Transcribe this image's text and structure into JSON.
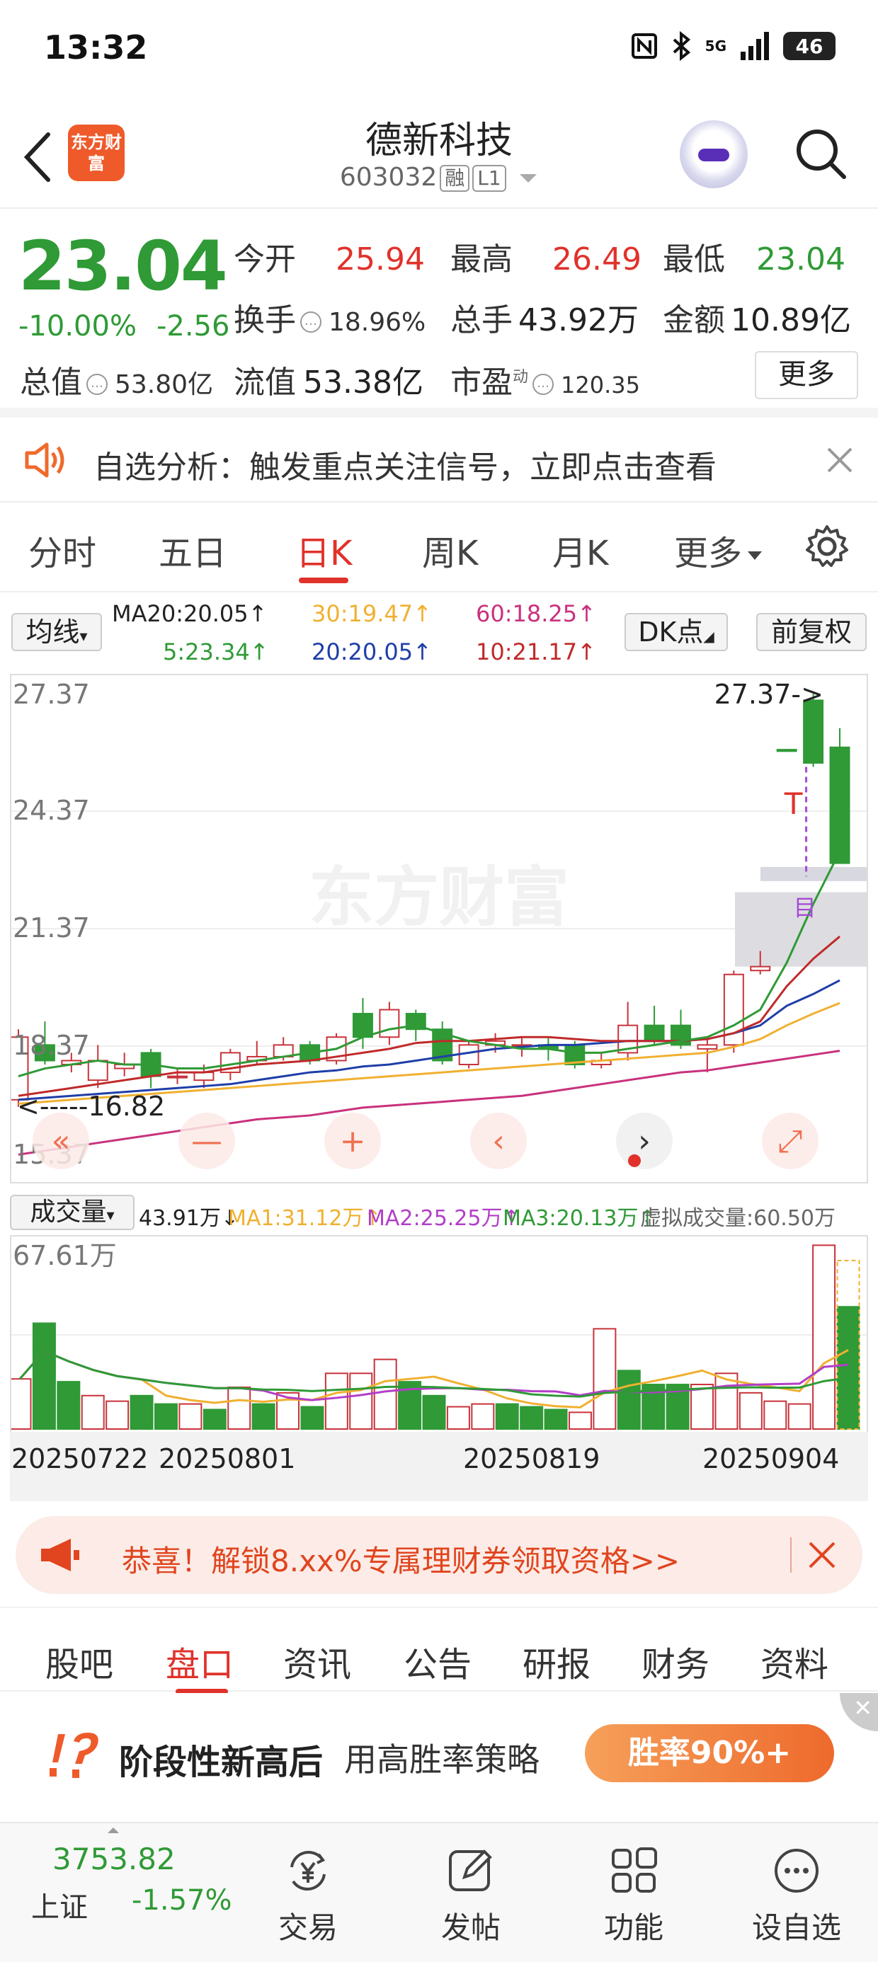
{
  "status_bar": {
    "time": "13:32",
    "network": "5G",
    "battery": "46"
  },
  "header": {
    "logo_text": "东方财富",
    "stock_name": "德新科技",
    "stock_code": "603032",
    "tag_margin": "融",
    "tag_level": "L1"
  },
  "quote": {
    "price": "23.04",
    "change_pct": "-10.00%",
    "change_abs": "-2.56",
    "open_label": "今开",
    "open": "25.94",
    "high_label": "最高",
    "high": "26.49",
    "low_label": "最低",
    "low": "23.04",
    "turnover_label": "换手",
    "turnover": "18.96%",
    "volume_label": "总手",
    "volume": "43.92万",
    "amount_label": "金额",
    "amount": "10.89亿",
    "mktcap_label": "总值",
    "mktcap": "53.80亿",
    "float_label": "流值",
    "float_cap": "53.38亿",
    "pe_label": "市盈",
    "pe_sup": "动",
    "pe": "120.35",
    "more_label": "更多"
  },
  "notice": {
    "text": "自选分析：触发重点关注信号，立即点击查看"
  },
  "ktabs": [
    "分时",
    "五日",
    "日K",
    "周K",
    "月K",
    "更多"
  ],
  "ma": {
    "select_label": "均线",
    "ma20_top": "MA20:20.05↑",
    "ma30": "30:19.47↑",
    "ma60": "60:18.25↑",
    "ma5": "5:23.34↑",
    "ma20": "20:20.05↑",
    "ma10": "10:21.17↑",
    "dk_label": "DK点",
    "adjust_label": "前复权"
  },
  "kchart": {
    "watermark": "东方财富",
    "y_labels": [
      "27.37",
      "24.37",
      "21.37",
      "18.37",
      "15.37"
    ],
    "max_marker": "27.37->",
    "min_marker": "<-----16.82",
    "mark_t": "T",
    "mark_b": "目"
  },
  "volume": {
    "select_label": "成交量",
    "current": "43.91万↓",
    "ma1": "MA1:31.12万↑",
    "ma2": "MA2:25.25万↑",
    "ma3": "MA3:20.13万↑",
    "virtual": "虚拟成交量:60.50万",
    "y_max": "67.61万"
  },
  "dates": [
    "20250722",
    "20250801",
    "20250819",
    "20250904"
  ],
  "promo": {
    "text": "恭喜！解锁8.xx%专属理财券领取资格>>"
  },
  "subtabs": [
    "股吧",
    "盘口",
    "资讯",
    "公告",
    "研报",
    "财务",
    "资料"
  ],
  "ad": {
    "title1": "阶段性新高后",
    "title2": "用高胜率策略",
    "button": "胜率90%+"
  },
  "bottom": {
    "index_value": "3753.82",
    "index_name": "上证",
    "index_change": "-1.57%",
    "nav": [
      "交易",
      "发帖",
      "功能",
      "设自选"
    ]
  },
  "chart_data": {
    "type": "candlestick",
    "title": "",
    "y_range": [
      15.37,
      27.37
    ],
    "candles": [
      {
        "o": 17.0,
        "c": 18.6,
        "h": 18.8,
        "l": 16.82
      },
      {
        "o": 18.4,
        "c": 18.0,
        "h": 19.0,
        "l": 17.9
      },
      {
        "o": 17.9,
        "c": 18.0,
        "h": 18.2,
        "l": 17.7
      },
      {
        "o": 17.5,
        "c": 18.0,
        "h": 18.4,
        "l": 17.3
      },
      {
        "o": 17.8,
        "c": 17.9,
        "h": 18.2,
        "l": 17.6
      },
      {
        "o": 18.2,
        "c": 17.6,
        "h": 18.3,
        "l": 17.3
      },
      {
        "o": 17.6,
        "c": 17.6,
        "h": 17.8,
        "l": 17.4
      },
      {
        "o": 17.5,
        "c": 17.7,
        "h": 17.9,
        "l": 17.3
      },
      {
        "o": 17.7,
        "c": 18.2,
        "h": 18.3,
        "l": 17.5
      },
      {
        "o": 18.0,
        "c": 18.1,
        "h": 18.5,
        "l": 17.9
      },
      {
        "o": 18.1,
        "c": 18.4,
        "h": 18.6,
        "l": 18.0
      },
      {
        "o": 18.4,
        "c": 18.0,
        "h": 18.5,
        "l": 17.9
      },
      {
        "o": 18.0,
        "c": 18.6,
        "h": 18.7,
        "l": 17.9
      },
      {
        "o": 19.2,
        "c": 18.6,
        "h": 19.6,
        "l": 18.3
      },
      {
        "o": 18.6,
        "c": 19.3,
        "h": 19.5,
        "l": 18.4
      },
      {
        "o": 19.2,
        "c": 18.8,
        "h": 19.3,
        "l": 18.5
      },
      {
        "o": 18.8,
        "c": 18.0,
        "h": 19.0,
        "l": 17.9
      },
      {
        "o": 17.9,
        "c": 18.4,
        "h": 18.5,
        "l": 17.8
      },
      {
        "o": 18.4,
        "c": 18.5,
        "h": 18.7,
        "l": 18.2
      },
      {
        "o": 18.4,
        "c": 18.4,
        "h": 18.6,
        "l": 18.1
      },
      {
        "o": 18.4,
        "c": 18.3,
        "h": 18.6,
        "l": 18.0
      },
      {
        "o": 18.4,
        "c": 17.9,
        "h": 18.5,
        "l": 17.8
      },
      {
        "o": 17.9,
        "c": 18.0,
        "h": 18.2,
        "l": 17.8
      },
      {
        "o": 18.2,
        "c": 18.9,
        "h": 19.5,
        "l": 18.0
      },
      {
        "o": 18.9,
        "c": 18.5,
        "h": 19.4,
        "l": 18.4
      },
      {
        "o": 18.9,
        "c": 18.4,
        "h": 19.3,
        "l": 18.3
      },
      {
        "o": 18.3,
        "c": 18.4,
        "h": 18.6,
        "l": 17.7
      },
      {
        "o": 18.4,
        "c": 20.2,
        "h": 20.3,
        "l": 18.2
      },
      {
        "o": 20.3,
        "c": 20.4,
        "h": 20.8,
        "l": 20.2
      },
      {
        "o": 25.94,
        "c": 25.9,
        "h": 25.94,
        "l": 25.9
      },
      {
        "o": 27.2,
        "c": 25.6,
        "h": 27.37,
        "l": 25.5
      },
      {
        "o": 26.0,
        "c": 23.04,
        "h": 26.49,
        "l": 23.04
      }
    ],
    "ma5": [
      17.6,
      17.8,
      17.9,
      18.0,
      17.9,
      17.9,
      17.8,
      17.8,
      17.9,
      18.0,
      18.1,
      18.2,
      18.3,
      18.6,
      18.8,
      18.9,
      18.7,
      18.5,
      18.4,
      18.3,
      18.3,
      18.2,
      18.2,
      18.3,
      18.4,
      18.5,
      18.6,
      18.9,
      19.3,
      20.5,
      22.0,
      23.34
    ],
    "ma10": [
      17.1,
      17.2,
      17.3,
      17.4,
      17.5,
      17.6,
      17.7,
      17.7,
      17.8,
      17.9,
      17.95,
      18.0,
      18.1,
      18.2,
      18.3,
      18.45,
      18.5,
      18.5,
      18.55,
      18.6,
      18.6,
      18.55,
      18.5,
      18.5,
      18.5,
      18.5,
      18.55,
      18.7,
      19.0,
      19.9,
      20.6,
      21.17
    ],
    "ma20": [
      17.0,
      17.05,
      17.1,
      17.15,
      17.2,
      17.25,
      17.3,
      17.35,
      17.4,
      17.5,
      17.6,
      17.7,
      17.75,
      17.85,
      17.9,
      18.0,
      18.1,
      18.2,
      18.3,
      18.35,
      18.4,
      18.4,
      18.45,
      18.5,
      18.5,
      18.5,
      18.55,
      18.7,
      18.9,
      19.4,
      19.7,
      20.05
    ],
    "ma30": [
      16.9,
      16.95,
      17.0,
      17.05,
      17.1,
      17.15,
      17.2,
      17.25,
      17.3,
      17.35,
      17.4,
      17.45,
      17.5,
      17.55,
      17.6,
      17.65,
      17.7,
      17.75,
      17.8,
      17.85,
      17.9,
      17.95,
      18.0,
      18.05,
      18.1,
      18.15,
      18.2,
      18.35,
      18.55,
      18.9,
      19.2,
      19.47
    ],
    "ma60": [
      15.6,
      15.7,
      15.8,
      15.9,
      16.0,
      16.1,
      16.2,
      16.3,
      16.4,
      16.5,
      16.55,
      16.6,
      16.7,
      16.8,
      16.85,
      16.9,
      16.95,
      17.0,
      17.05,
      17.1,
      17.2,
      17.3,
      17.4,
      17.5,
      17.6,
      17.7,
      17.75,
      17.85,
      17.95,
      18.05,
      18.15,
      18.25
    ],
    "volume": {
      "y_max": 67.61,
      "bars": [
        18,
        38,
        17,
        12,
        10,
        12,
        9,
        9,
        7,
        15,
        9,
        13,
        8,
        20,
        20,
        25,
        17,
        12,
        8,
        9,
        9,
        8,
        7,
        6,
        36,
        21,
        16,
        16,
        16,
        20,
        13,
        10,
        9,
        66,
        43.91
      ],
      "up": [
        true,
        false,
        false,
        true,
        true,
        false,
        false,
        true,
        false,
        true,
        false,
        true,
        false,
        true,
        true,
        true,
        false,
        false,
        true,
        true,
        false,
        false,
        false,
        true,
        true,
        false,
        false,
        false,
        true,
        true,
        true,
        true,
        true,
        true,
        false
      ],
      "virtual": 60.5
    }
  }
}
